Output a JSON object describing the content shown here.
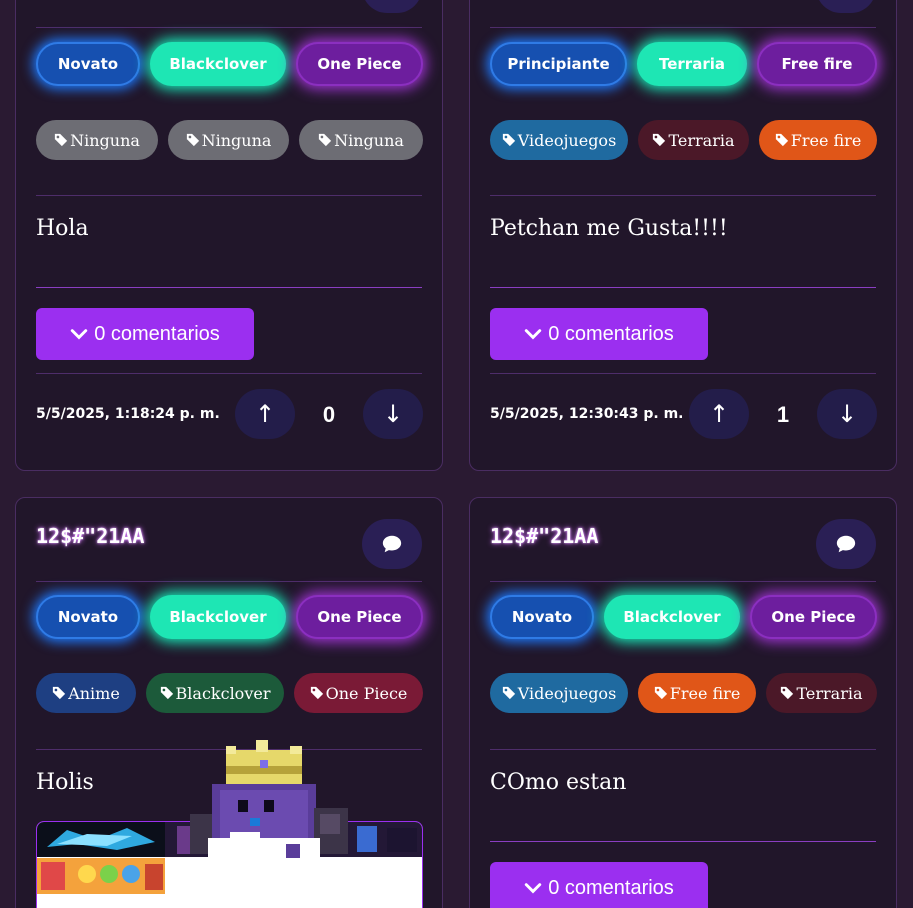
{
  "posts": [
    {
      "levels": [
        "Novato",
        "Blackclover",
        "One Piece"
      ],
      "tags": [
        "Ninguna",
        "Ninguna",
        "Ninguna"
      ],
      "body": "Hola",
      "comments_label": "0 comentarios",
      "date": "5/5/2025, 1:18:24 p. m.",
      "score": "0"
    },
    {
      "levels": [
        "Principiante",
        "Terraria",
        "Free fire"
      ],
      "tags": [
        "Videojuegos",
        "Terraria",
        "Free fire"
      ],
      "body": "Petchan me Gusta!!!!",
      "comments_label": "0 comentarios",
      "date": "5/5/2025, 12:30:43 p. m.",
      "score": "1"
    },
    {
      "title": "12$#\"21AA",
      "levels": [
        "Novato",
        "Blackclover",
        "One Piece"
      ],
      "tags": [
        "Anime",
        "Blackclover",
        "One Piece"
      ],
      "body": "Holis"
    },
    {
      "title": "12$#\"21AA",
      "levels": [
        "Novato",
        "Blackclover",
        "One Piece"
      ],
      "tags": [
        "Videojuegos",
        "Free fire",
        "Terraria"
      ],
      "body": "COmo estan",
      "comments_label": "0 comentarios"
    }
  ],
  "icons": {
    "chat": "chat-bubble-icon",
    "tag": "tag-icon",
    "chevron": "chevron-down-icon",
    "up": "↑",
    "down": "↓"
  },
  "colors": {
    "accent": "#9b2ff0",
    "background": "#2a1a32",
    "card": "#21162a"
  }
}
